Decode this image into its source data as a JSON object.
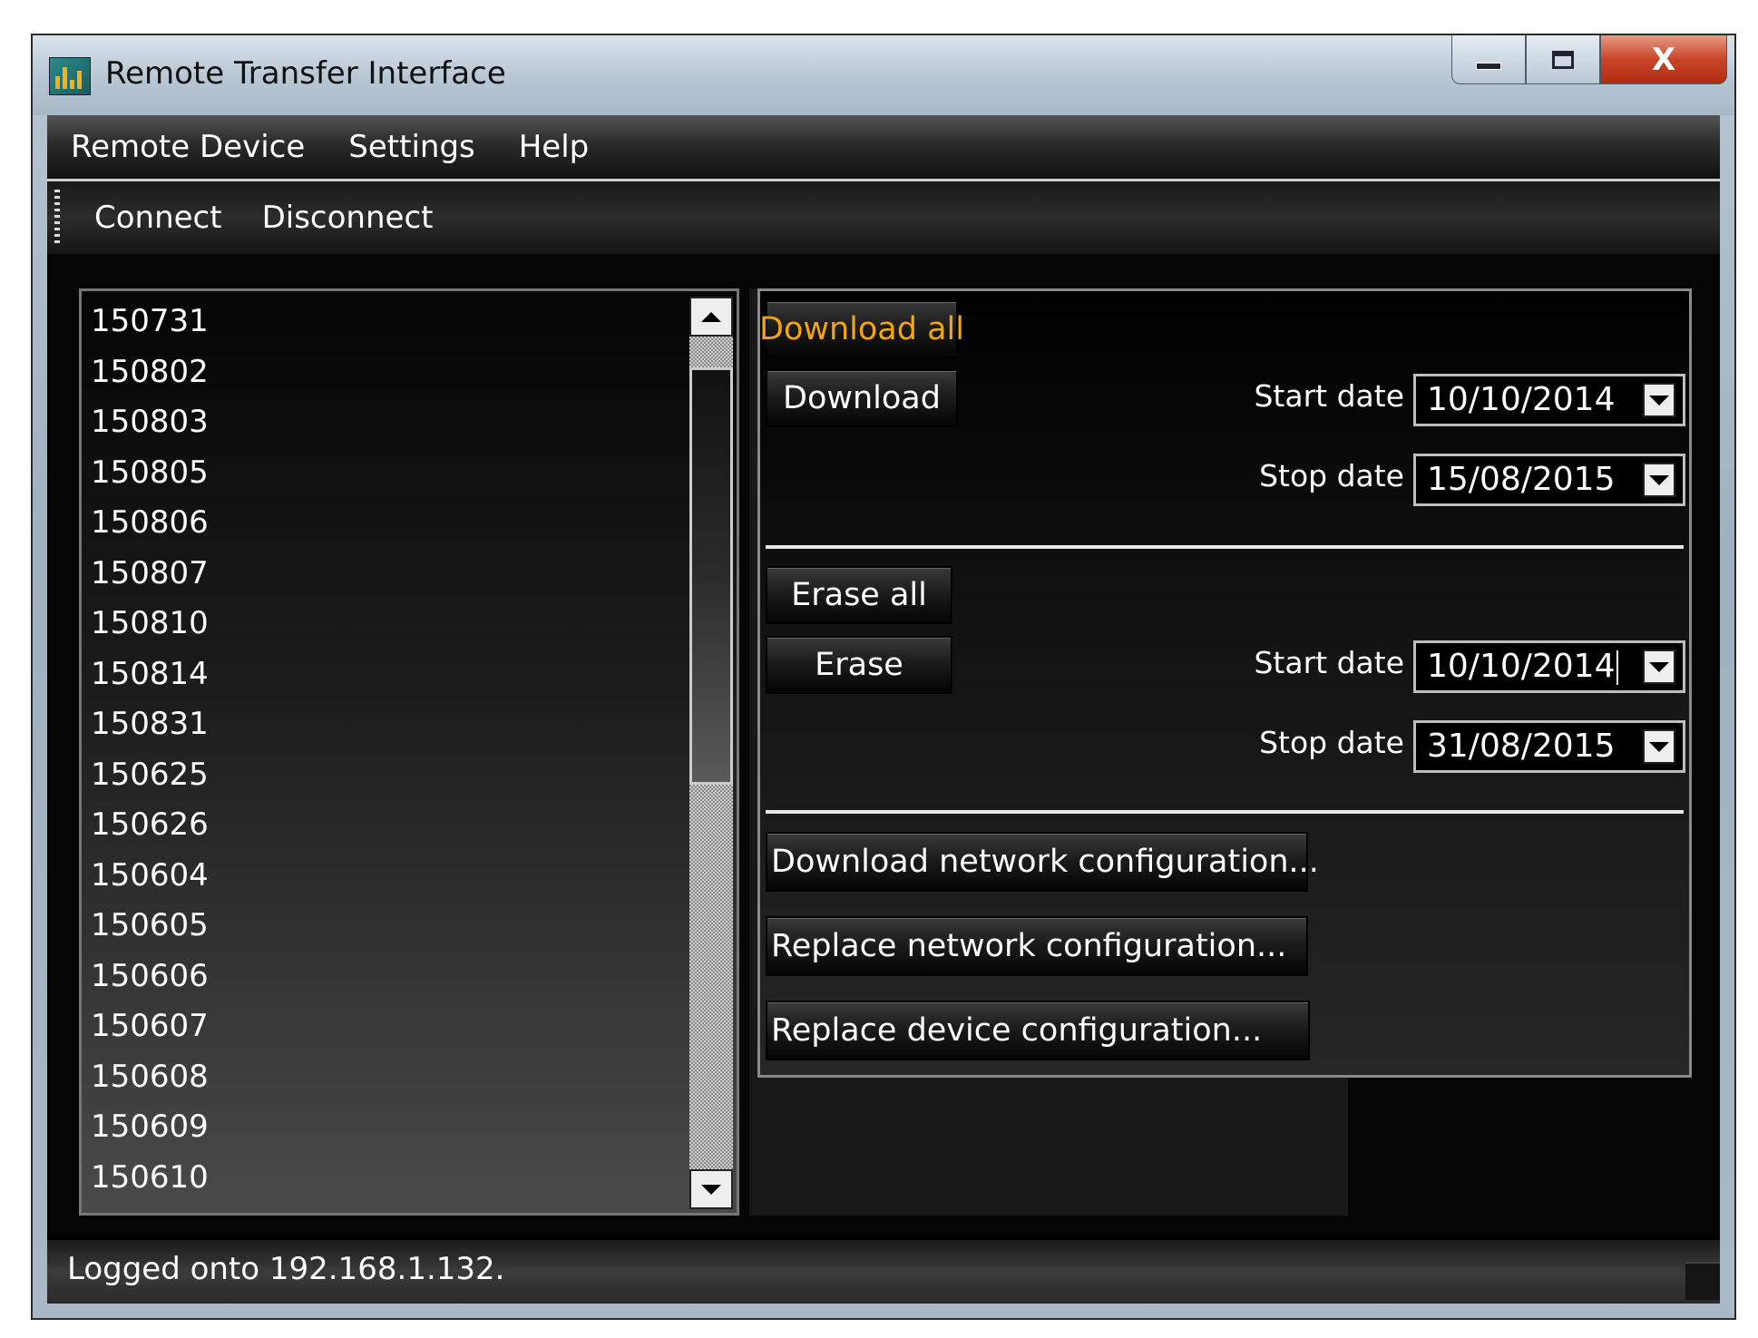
{
  "window": {
    "title": "Remote Transfer Interface",
    "controls": {
      "minimize": "",
      "maximize": "",
      "close": "X"
    }
  },
  "menu": [
    "Remote Device",
    "Settings",
    "Help"
  ],
  "toolbar": [
    "Connect",
    "Disconnect"
  ],
  "file_list": [
    "150731",
    "150802",
    "150803",
    "150805",
    "150806",
    "150807",
    "150810",
    "150814",
    "150831",
    "150625",
    "150626",
    "150604",
    "150605",
    "150606",
    "150607",
    "150608",
    "150609",
    "150610"
  ],
  "download": {
    "download_all_label": "Download all",
    "download_label": "Download",
    "start_label": "Start date",
    "start_value": "10/10/2014",
    "stop_label": "Stop date",
    "stop_value": "15/08/2015"
  },
  "erase": {
    "erase_all_label": "Erase all",
    "erase_label": "Erase",
    "start_label": "Start date",
    "start_value": "10/10/2014",
    "stop_label": "Stop date",
    "stop_value": "31/08/2015"
  },
  "config": {
    "download_network": "Download network configuration...",
    "replace_network": "Replace network configuration...",
    "replace_device": "Replace device configuration..."
  },
  "status": "Logged onto 192.168.1.132.",
  "colors": {
    "accent": "#f2a50f",
    "close_button": "#c8452a",
    "background": "#050505"
  }
}
